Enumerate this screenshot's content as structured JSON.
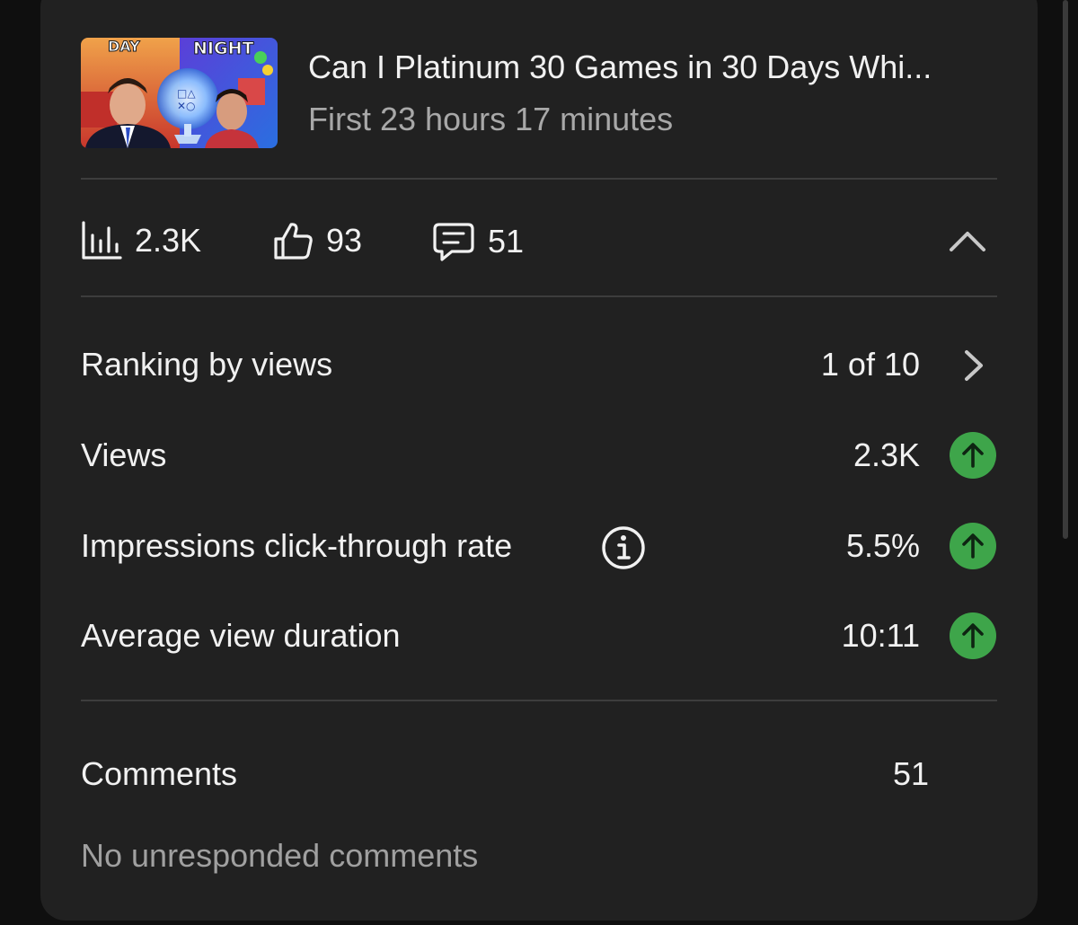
{
  "video": {
    "thumbnail_text_left": "DAY",
    "thumbnail_text_right": "NIGHT",
    "title": "Can I Platinum 30 Games in 30 Days Whi...",
    "subtitle": "First 23 hours 17 minutes"
  },
  "stats": {
    "views": "2.3K",
    "likes": "93",
    "comments": "51"
  },
  "metrics": {
    "ranking": {
      "label": "Ranking by views",
      "value": "1 of 10"
    },
    "views": {
      "label": "Views",
      "value": "2.3K"
    },
    "ctr": {
      "label": "Impressions click-through rate",
      "value": "5.5%"
    },
    "avd": {
      "label": "Average view duration",
      "value": "10:11"
    }
  },
  "comments": {
    "label": "Comments",
    "count": "51",
    "note": "No unresponded comments"
  },
  "colors": {
    "background": "#0f0f0f",
    "card": "#212121",
    "positive": "#3ea54a"
  },
  "icons": {
    "views": "bar-chart-icon",
    "likes": "thumbs-up-icon",
    "comments": "comment-icon",
    "collapse": "chevron-up-icon",
    "ranking": "chevron-right-icon",
    "info": "info-icon",
    "trend": "arrow-up-icon"
  }
}
